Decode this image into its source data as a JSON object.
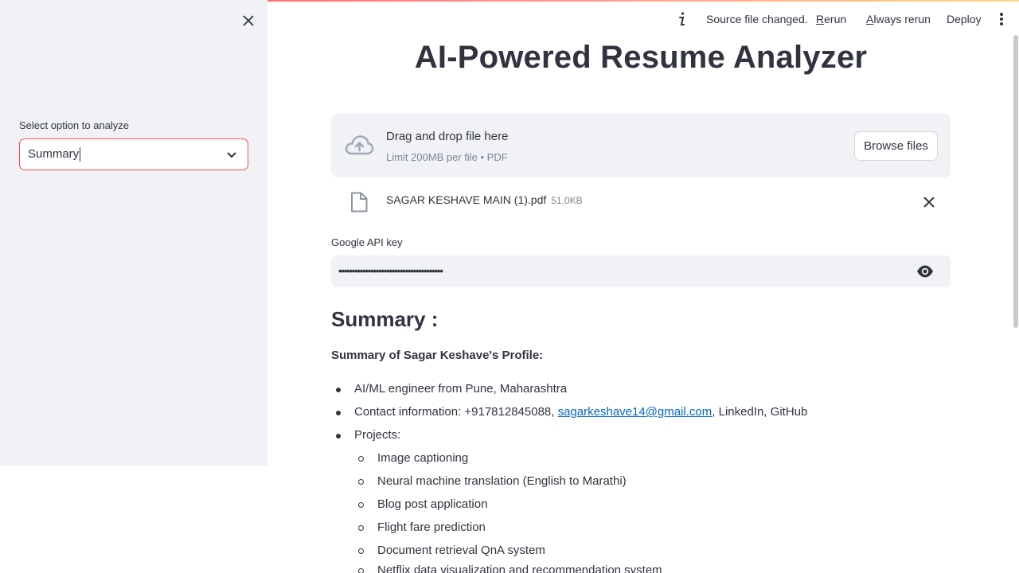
{
  "header": {
    "source_changed": "Source file changed.",
    "rerun_first": "R",
    "rerun_rest": "erun",
    "always_first": "A",
    "always_rest": "lways rerun",
    "deploy": "Deploy"
  },
  "sidebar": {
    "select_label": "Select option to analyze",
    "select_value": "Summary"
  },
  "main": {
    "title": "AI-Powered Resume Analyzer",
    "uploader": {
      "title": "Drag and drop file here",
      "subtitle": "Limit 200MB per file • PDF",
      "browse_label": "Browse files"
    },
    "file": {
      "name": "SAGAR KESHAVE MAIN (1).pdf",
      "size": "51.0KB"
    },
    "api": {
      "label": "Google API key",
      "masked_value": "•••••••••••••••••••••••••••••••••••••••"
    },
    "summary": {
      "heading": "Summary :",
      "subheading": "Summary of Sagar Keshave's Profile:",
      "item1": "AI/ML engineer from Pune, Maharashtra",
      "contact_prefix": "Contact information: +917812845088, ",
      "contact_email": "sagarkeshave14@gmail.com",
      "contact_suffix": ", LinkedIn, GitHub",
      "projects_label": "Projects:",
      "projects": [
        "Image captioning",
        "Neural machine translation (English to Marathi)",
        "Blog post application",
        "Flight fare prediction",
        "Document retrieval QnA system",
        "Netflix data visualization and recommendation system"
      ]
    }
  },
  "colors": {
    "accent": "#ff4b4b",
    "sidebar_bg": "#f0f2f6",
    "text": "#31333f",
    "muted": "#808495",
    "link": "#0068c9"
  }
}
